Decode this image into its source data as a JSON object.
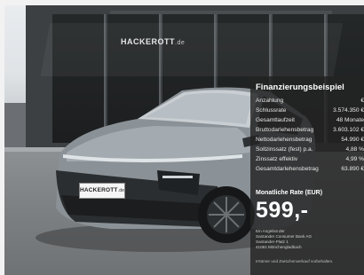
{
  "scene": {
    "storefront_sign": "HACKEROTT",
    "storefront_sign_suffix": ".de",
    "license_plate": "HACKEROTT",
    "license_plate_suffix": ".de"
  },
  "financing": {
    "title": "Finanzierungsbeispiel",
    "rows": [
      {
        "label": "Anzahlung",
        "value": "€"
      },
      {
        "label": "Schlussrate",
        "value": "3.574.350 €"
      },
      {
        "label": "Gesamtlaufzeit",
        "value": "48 Monate"
      },
      {
        "label": "Bruttodarlehensbetrag",
        "value": "3.603.102 €"
      },
      {
        "label": "Nettodarlehensbetrag",
        "value": "54.990 €"
      },
      {
        "label": "Sollzinssatz (fest) p.a.",
        "value": "4,88 %"
      },
      {
        "label": "Zinssatz effektiv",
        "value": "4,99 %"
      },
      {
        "label": "Gesamtdarlehensbetrag",
        "value": "63.890 €"
      }
    ],
    "rate_title": "Monatliche Rate (EUR)",
    "rate_value": "599,-",
    "provider_lines": [
      "Ein Angebot der",
      "Santander Consumer Bank AG",
      "Santander-Platz 1",
      "41061 Mönchengladbach"
    ],
    "note": "Irrtümer und Zwischenverkauf vorbehalten."
  }
}
